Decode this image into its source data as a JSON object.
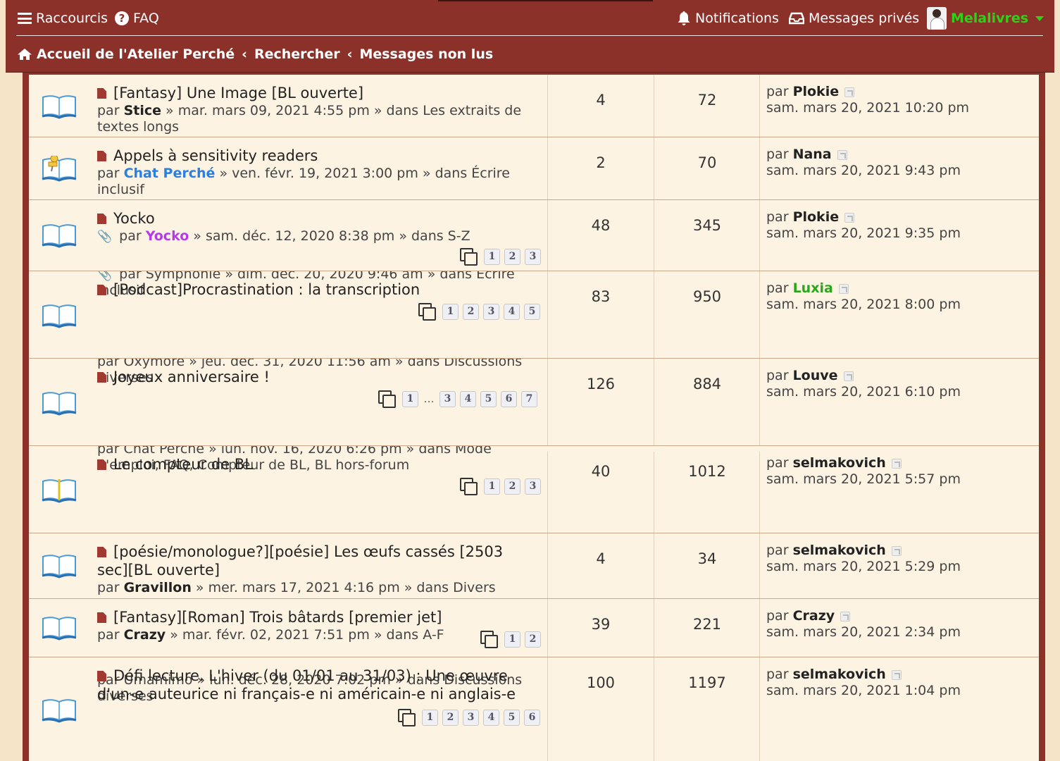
{
  "header": {
    "shortcuts": "Raccourcis",
    "faq": "FAQ",
    "notifications": "Notifications",
    "private_messages": "Messages privés",
    "username": "Melalivres",
    "breadcrumb": [
      "Accueil de l'Atelier Perché",
      "Rechercher",
      "Messages non lus"
    ]
  },
  "topics": [
    {
      "title": "[Fantasy] Une Image [BL ouverte]",
      "by": "par",
      "author": "Stice",
      "meta_rest": " » mar. mars 09, 2021 4:55 pm » dans Les extraits de textes longs",
      "replies": "4",
      "views": "72",
      "last_by": "par",
      "last_author": "Plokie",
      "last_date": "sam. mars 20, 2021 10:20 pm"
    },
    {
      "title": "Appels à sensitivity readers",
      "by": "par",
      "author": "Chat Perché",
      "meta_rest": " » ven. févr. 19, 2021 3:00 pm » dans Écrire inclusif",
      "replies": "2",
      "views": "70",
      "last_by": "par",
      "last_author": "Nana",
      "last_date": "sam. mars 20, 2021 9:43 pm"
    },
    {
      "title": "Yocko",
      "by": "par",
      "author": "Yocko",
      "meta_rest": " » sam. déc. 12, 2020 8:38 pm » dans S-Z",
      "replies": "48",
      "views": "345",
      "last_by": "par",
      "last_author": "Plokie",
      "last_date": "sam. mars 20, 2021 9:35 pm",
      "pages": [
        "1",
        "2",
        "3"
      ]
    },
    {
      "title": "[Podcast]Procrastination : la transcription",
      "ghost": "par Symphonie » dim. déc. 20, 2020 9:46 am » dans Écrire",
      "ghost2": "inclusif",
      "replies": "83",
      "views": "950",
      "last_by": "par",
      "last_author": "Luxia",
      "last_date": "sam. mars 20, 2021 8:00 pm",
      "pages": [
        "1",
        "2",
        "3",
        "4",
        "5"
      ]
    },
    {
      "title": "Joyeux anniversaire !",
      "ghost": "par Oxymore » jeu. déc. 31, 2020 11:56 am » dans Discussions",
      "ghost2": "diverses",
      "replies": "126",
      "views": "884",
      "last_by": "par",
      "last_author": "Louve",
      "last_date": "sam. mars 20, 2021 6:10 pm",
      "pages": [
        "1",
        "…",
        "3",
        "4",
        "5",
        "6",
        "7"
      ]
    },
    {
      "title": "Le compteur de BL",
      "ghost": "par Chat Perché » lun. nov. 16, 2020 6:26 pm » dans Mode",
      "ghost2": "d'emploi, FAQ, Compteur de BL, BL hors-forum",
      "replies": "40",
      "views": "1012",
      "last_by": "par",
      "last_author": "selmakovich",
      "last_date": "sam. mars 20, 2021 5:57 pm",
      "pages": [
        "1",
        "2",
        "3"
      ]
    },
    {
      "title": "[poésie/monologue?][poésie] Les œufs cassés [2503",
      "title2": "sec][BL ouverte]",
      "by": "par",
      "author": "Gravillon",
      "meta_rest": " » mer. mars 17, 2021 4:16 pm » dans Divers",
      "replies": "4",
      "views": "34",
      "last_by": "par",
      "last_author": "selmakovich",
      "last_date": "sam. mars 20, 2021 5:29 pm"
    },
    {
      "title": "[Fantasy][Roman] Trois bâtards [premier jet]",
      "by": "par",
      "author": "Crazy",
      "meta_rest": " » mar. févr. 02, 2021 7:51 pm » dans A-F",
      "replies": "39",
      "views": "221",
      "last_by": "par",
      "last_author": "Crazy",
      "last_date": "sam. mars 20, 2021 2:34 pm",
      "pages": [
        "1",
        "2"
      ]
    },
    {
      "title": "Défi lecture. L'hiver (du 01/01 au 31/03) : Une œuvre",
      "title2": "d'un-e auteurice ni français-e ni américain-e ni anglais-e",
      "ghost": "par Umamimo » lun. déc. 28, 2020 7:02 pm » dans Discussions",
      "ghost2": "diverses",
      "replies": "100",
      "views": "1197",
      "last_by": "par",
      "last_author": "selmakovich",
      "last_date": "sam. mars 20, 2021 1:04 pm",
      "pages": [
        "1",
        "2",
        "3",
        "4",
        "5",
        "6"
      ]
    }
  ]
}
